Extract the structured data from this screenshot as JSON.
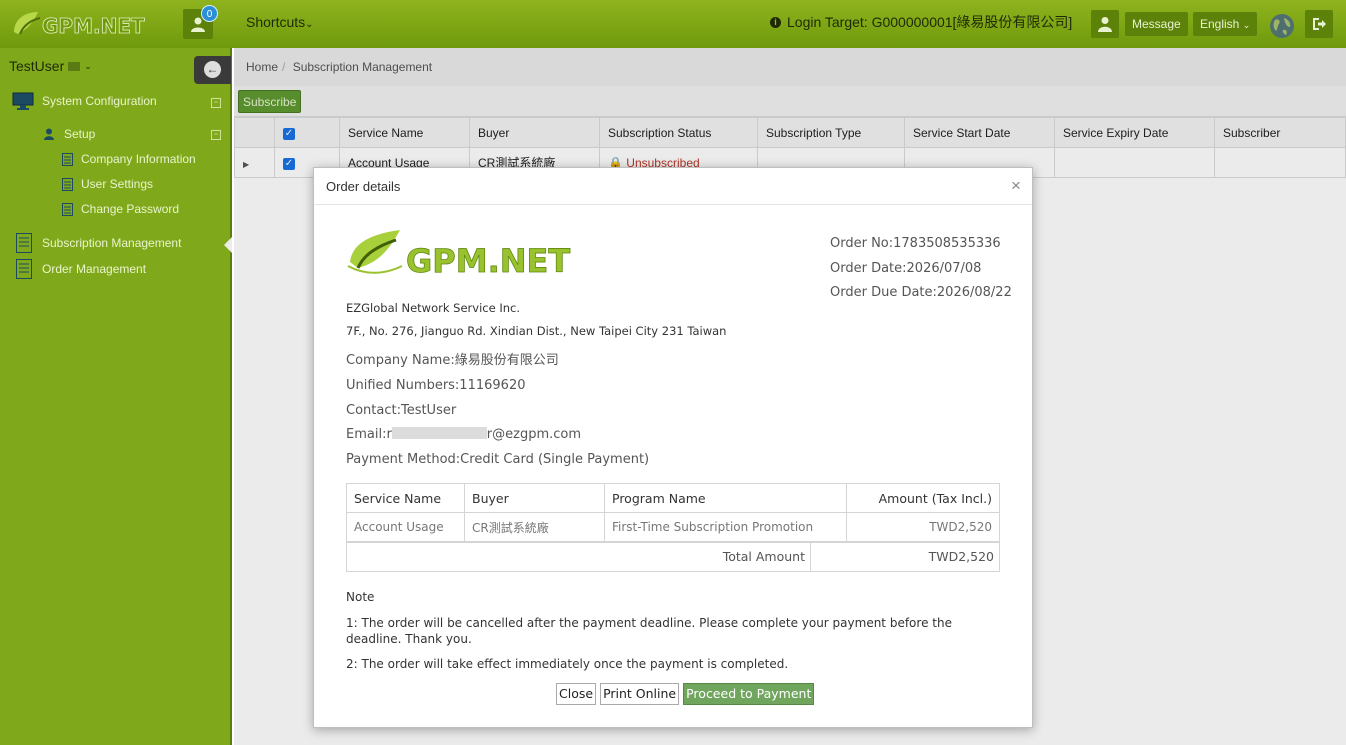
{
  "header": {
    "logo_text": "GPM.NET",
    "notification_count": "0",
    "shortcuts_label": "Shortcuts",
    "login_target": "Login Target: G000000001[綠易股份有限公司]",
    "message_label": "Message",
    "language_label": "English"
  },
  "sidebar": {
    "username": "TestUser",
    "items": [
      {
        "label": "System Configuration"
      },
      {
        "label": "Setup"
      },
      {
        "label": "Company Information"
      },
      {
        "label": "User Settings"
      },
      {
        "label": "Change Password"
      },
      {
        "label": "Subscription Management"
      },
      {
        "label": "Order Management"
      }
    ]
  },
  "breadcrumb": {
    "home": "Home",
    "separator": "/",
    "current": "Subscription Management"
  },
  "toolbar": {
    "subscribe_label": "Subscribe"
  },
  "grid": {
    "columns": [
      "Service Name",
      "Buyer",
      "Subscription Status",
      "Subscription Type",
      "Service Start Date",
      "Service Expiry Date",
      "Subscriber"
    ],
    "rows": [
      {
        "service_name": "Account Usage",
        "buyer": "CR測試系統廠",
        "status": "Unsubscribed",
        "type": "",
        "start": "",
        "expiry": "",
        "subscriber": ""
      }
    ]
  },
  "modal": {
    "title": "Order details",
    "close_symbol": "×",
    "order_no": "Order No:1783508535336",
    "order_date": "Order Date:2026/07/08",
    "order_due_date": "Order Due Date:2026/08/22",
    "company_name_en": "EZGlobal Network Service Inc.",
    "company_address": "7F., No. 276, Jianguo Rd. Xindian Dist., New Taipei City 231 Taiwan",
    "company_name": "Company Name:綠易股份有限公司",
    "unified_numbers": "Unified Numbers:11169620",
    "contact": "Contact:TestUser",
    "email_prefix": "Email:r",
    "email_suffix": "r@ezgpm.com",
    "payment_method": "Payment Method:Credit Card (Single Payment)",
    "table": {
      "headers": [
        "Service Name",
        "Buyer",
        "Program Name",
        "Amount (Tax Incl.)"
      ],
      "rows": [
        [
          "Account Usage",
          "CR測試系統廠",
          "First-Time Subscription Promotion",
          "TWD2,520"
        ]
      ]
    },
    "total_label": "Total Amount",
    "total_value": "TWD2,520",
    "note_title": "Note",
    "note_1": "1: The order will be cancelled after the payment deadline. Please complete your payment before the deadline. Thank you.",
    "note_2": "2: The order will take effect immediately once the payment is completed.",
    "close_label": "Close",
    "print_label": "Print Online",
    "proceed_label": "Proceed to Payment"
  },
  "colors": {
    "brand_green": "#80a81b",
    "topbar_green": "#8fb31e",
    "proceed_green": "#6fa55d",
    "status_red": "#c0392b"
  }
}
